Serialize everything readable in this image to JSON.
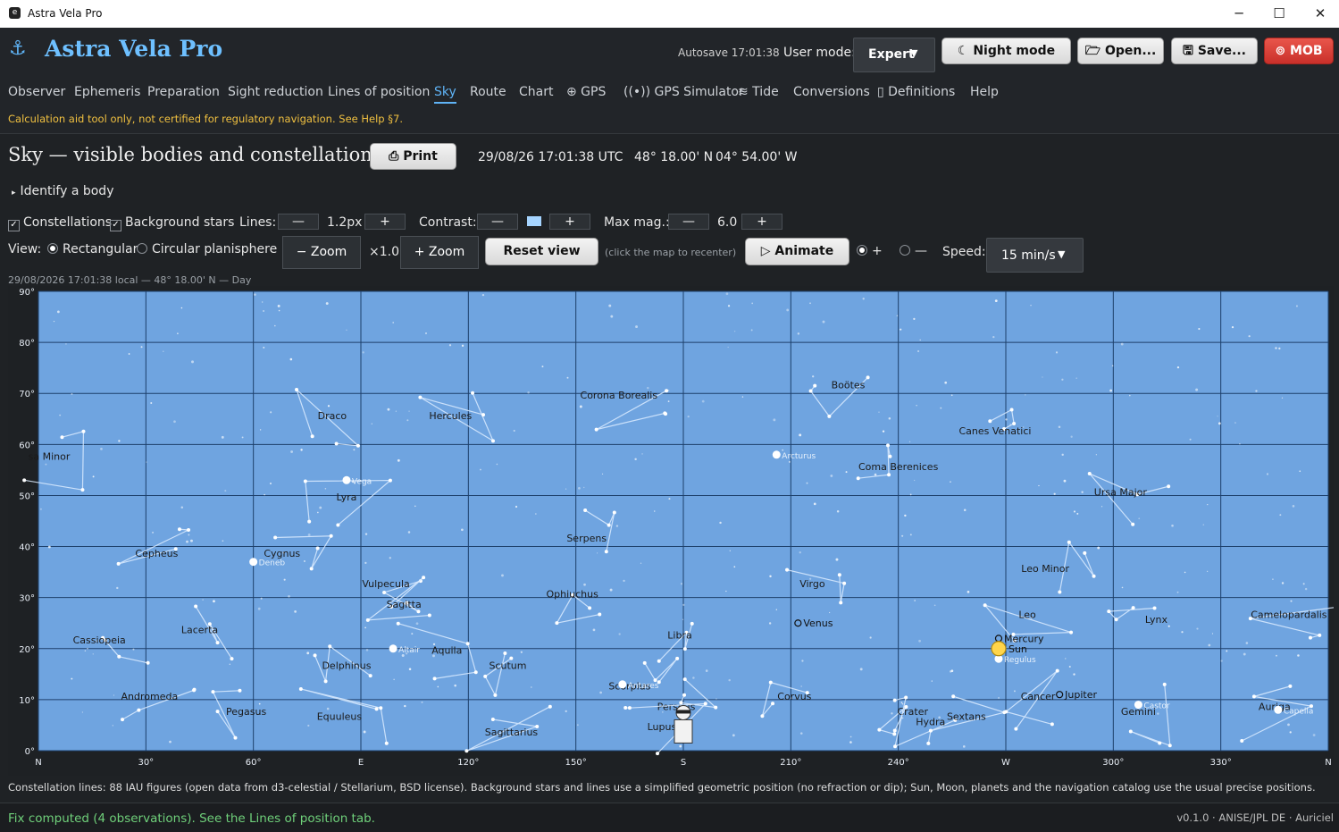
{
  "window": {
    "title": "Astra Vela Pro",
    "app_icon": "e",
    "minimize": "─",
    "maximize": "☐",
    "close": "✕"
  },
  "header": {
    "brand": "Astra Vela Pro",
    "brand_icon": "⚓",
    "autosave": "Autosave 17:01:38",
    "user_mode_label": "User mode:",
    "user_mode_value": "Expert",
    "buttons": {
      "night": "Night mode",
      "open": "Open...",
      "save": "Save...",
      "mob": "MOB"
    }
  },
  "tabs": [
    {
      "label": "Observer"
    },
    {
      "label": "Ephemeris"
    },
    {
      "label": "Preparation"
    },
    {
      "label": "Sight reduction"
    },
    {
      "label": "Lines of position"
    },
    {
      "label": "Sky"
    },
    {
      "label": "Route"
    },
    {
      "label": "Chart"
    },
    {
      "label": "⊕ GPS"
    },
    {
      "label": "((•)) GPS Simulator"
    },
    {
      "label": "≋ Tide"
    },
    {
      "label": "Conversions"
    },
    {
      "label": "▯ Definitions"
    },
    {
      "label": "Help"
    }
  ],
  "warning": "Calculation aid tool only, not certified for regulatory navigation. See Help §7.",
  "page": {
    "title": "Sky — visible bodies and constellations",
    "print": "Print",
    "datetime": "29/08/26 17:01:38 UTC",
    "lat": "48° 18.00' N",
    "lon": "04° 54.00' W",
    "identify": "Identify a body"
  },
  "controls": {
    "constellations": "Constellations",
    "background_stars": "Background stars",
    "lines_label": "Lines:",
    "lines_value": "1.2px",
    "contrast_label": "Contrast:",
    "maxmag_label": "Max mag.:",
    "maxmag_value": "6.0",
    "minus": "—",
    "plus": "+",
    "view_label": "View:",
    "rectangular": "Rectangular",
    "circular": "Circular planisphere",
    "zoom_out": "− Zoom",
    "zoom_value": "×1.0",
    "zoom_in": "+ Zoom",
    "reset_view": "Reset view",
    "recenter_hint": "(click the map to recenter)",
    "animate": "▷ Animate",
    "speed_label": "Speed:",
    "speed_value": "15 min/s"
  },
  "map": {
    "caption": "29/08/2026  17:01:38 local  —  48° 18.00' N  —  Day",
    "sky_color": "#6fa4e0",
    "alt_labels": [
      "90°",
      "80°",
      "70°",
      "60°",
      "50°",
      "40°",
      "30°",
      "20°",
      "10°",
      "0°"
    ],
    "az_labels": [
      "N",
      "30°",
      "60°",
      "E",
      "120°",
      "150°",
      "S",
      "210°",
      "240°",
      "W",
      "300°",
      "330°",
      "N"
    ],
    "constellations": [
      {
        "name": "sa Minor",
        "az": 3,
        "alt": 57
      },
      {
        "name": "Draco",
        "az": 82,
        "alt": 65
      },
      {
        "name": "Hercules",
        "az": 115,
        "alt": 65
      },
      {
        "name": "Corona Borealis",
        "az": 162,
        "alt": 69
      },
      {
        "name": "Boötes",
        "az": 226,
        "alt": 71
      },
      {
        "name": "Canes Venatici",
        "az": 267,
        "alt": 62
      },
      {
        "name": "Coma Berenices",
        "az": 240,
        "alt": 55
      },
      {
        "name": "Ursa Major",
        "az": 302,
        "alt": 50
      },
      {
        "name": "Lyra",
        "az": 86,
        "alt": 49
      },
      {
        "name": "Cepheus",
        "az": 33,
        "alt": 38
      },
      {
        "name": "Cygnus",
        "az": 68,
        "alt": 38
      },
      {
        "name": "Serpens",
        "az": 153,
        "alt": 41
      },
      {
        "name": "Vulpecula",
        "az": 97,
        "alt": 32
      },
      {
        "name": "Sagitta",
        "az": 102,
        "alt": 28
      },
      {
        "name": "Ophiuchus",
        "az": 149,
        "alt": 30
      },
      {
        "name": "Virgo",
        "az": 216,
        "alt": 32
      },
      {
        "name": "Leo Minor",
        "az": 281,
        "alt": 35
      },
      {
        "name": "Leo",
        "az": 276,
        "alt": 26
      },
      {
        "name": "Lynx",
        "az": 312,
        "alt": 25
      },
      {
        "name": "Camelopardalis",
        "az": 349,
        "alt": 26
      },
      {
        "name": "Lacerta",
        "az": 45,
        "alt": 23
      },
      {
        "name": "Cassiopeia",
        "az": 17,
        "alt": 21
      },
      {
        "name": "Libra",
        "az": 179,
        "alt": 22
      },
      {
        "name": "Aquila",
        "az": 114,
        "alt": 19
      },
      {
        "name": "Delphinus",
        "az": 86,
        "alt": 16
      },
      {
        "name": "Scutum",
        "az": 131,
        "alt": 16
      },
      {
        "name": "Scorpius",
        "az": 165,
        "alt": 12
      },
      {
        "name": "Corvus",
        "az": 211,
        "alt": 10
      },
      {
        "name": "Andromeda",
        "az": 31,
        "alt": 10
      },
      {
        "name": "Pegasus",
        "az": 58,
        "alt": 7
      },
      {
        "name": "Equuleus",
        "az": 84,
        "alt": 6
      },
      {
        "name": "Crater",
        "az": 244,
        "alt": 7
      },
      {
        "name": "Hydra",
        "az": 249,
        "alt": 5
      },
      {
        "name": "Sextans",
        "az": 259,
        "alt": 6
      },
      {
        "name": "Sagittarius",
        "az": 132,
        "alt": 3
      },
      {
        "name": "Perseus",
        "az": 178,
        "alt": 8
      },
      {
        "name": "Lupus",
        "az": 174,
        "alt": 4
      },
      {
        "name": "Cancer",
        "az": 279,
        "alt": 10
      },
      {
        "name": "Gemini",
        "az": 307,
        "alt": 7
      },
      {
        "name": "Auriga",
        "az": 345,
        "alt": 8
      }
    ],
    "named_stars": [
      {
        "name": "Vega",
        "az": 86,
        "alt": 53
      },
      {
        "name": "Deneb",
        "az": 60,
        "alt": 37
      },
      {
        "name": "Altair",
        "az": 99,
        "alt": 20
      },
      {
        "name": "Arcturus",
        "az": 206,
        "alt": 58
      },
      {
        "name": "Antares",
        "az": 163,
        "alt": 13
      },
      {
        "name": "Regulus",
        "az": 268,
        "alt": 18
      },
      {
        "name": "Castor",
        "az": 307,
        "alt": 9
      },
      {
        "name": "Capella",
        "az": 346,
        "alt": 8
      }
    ],
    "bodies": [
      {
        "name": "Venus",
        "az": 212,
        "alt": 25,
        "color": "#ffffff"
      },
      {
        "name": "Mercury",
        "az": 268,
        "alt": 22,
        "color": "#ffffff"
      },
      {
        "name": "Sun",
        "az": 268,
        "alt": 20,
        "color": "#ffd54a"
      },
      {
        "name": "Jupiter",
        "az": 285,
        "alt": 11,
        "color": "#ffffff"
      }
    ]
  },
  "footnote": "Constellation lines: 88 IAU figures (open data from d3-celestial / Stellarium, BSD license). Background stars and lines use a simplified geometric position (no refraction or dip); Sun, Moon, planets and the navigation catalog use the usual precise positions.",
  "status": {
    "fix": "Fix computed (4 observations). See the Lines of position tab.",
    "version": "v0.1.0 · ANISE/JPL DE · Auriciel"
  }
}
